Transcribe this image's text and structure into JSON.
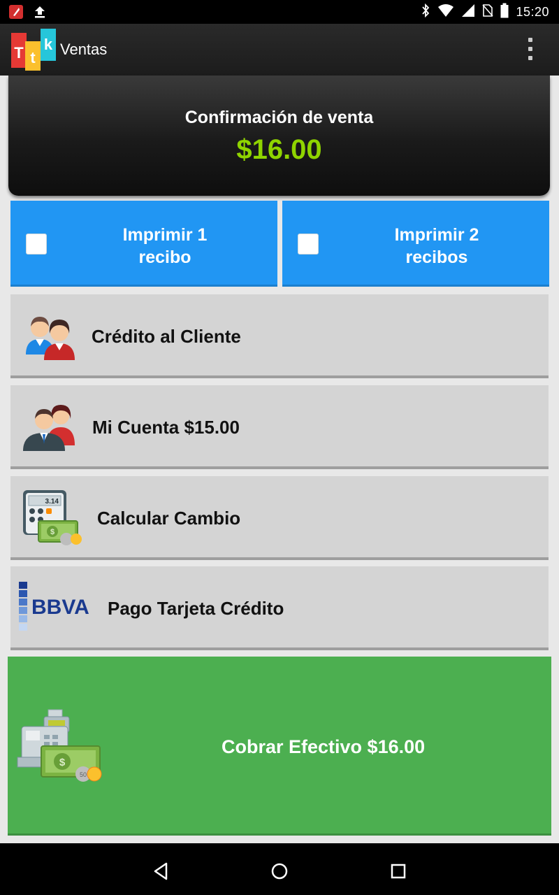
{
  "status_bar": {
    "time": "15:20",
    "left_icons": [
      "notification-app-icon",
      "upload-icon"
    ],
    "right_icons": [
      "bluetooth-icon",
      "wifi-icon",
      "signal-icon",
      "no-sim-icon",
      "battery-icon"
    ]
  },
  "app_bar": {
    "logo_letters": [
      "T",
      "t",
      "k"
    ],
    "title": "Ventas",
    "menu_icon": "overflow-menu-icon"
  },
  "confirmation": {
    "title": "Confirmación de venta",
    "amount": "$16.00",
    "amount_color": "#8fd400"
  },
  "print_options": [
    {
      "line1": "Imprimir 1",
      "line2": "recibo",
      "checked": false
    },
    {
      "line1": "Imprimir 2",
      "line2": "recibos",
      "checked": false
    }
  ],
  "payment_options": [
    {
      "label": "Crédito al Cliente",
      "icon": "customers-icon"
    },
    {
      "label": "Mi Cuenta $15.00",
      "icon": "account-users-icon"
    },
    {
      "label": "Calcular Cambio",
      "icon": "calculator-money-icon",
      "icon_text": "3.14"
    },
    {
      "label": "Pago Tarjeta Crédito",
      "icon": "bbva-logo",
      "icon_text": "BBVA"
    }
  ],
  "cash_button": {
    "label": "Cobrar Efectivo $16.00",
    "icon": "cash-register-icon",
    "color": "#4caf50"
  },
  "colors": {
    "print_blue": "#2196f3",
    "option_gray": "#d4d4d4"
  },
  "nav_bar": {
    "buttons": [
      "back-icon",
      "home-icon",
      "recents-icon"
    ]
  }
}
